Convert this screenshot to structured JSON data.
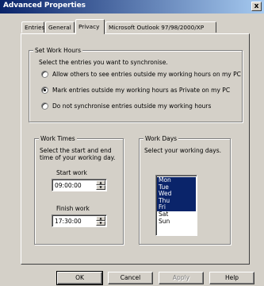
{
  "window": {
    "title": "Advanced Properties",
    "close_label": "x"
  },
  "tabs": [
    {
      "label": "Entries",
      "active": false
    },
    {
      "label": "General",
      "active": false
    },
    {
      "label": "Privacy",
      "active": true
    },
    {
      "label": "Microsoft Outlook 97/98/2000/XP",
      "active": false
    }
  ],
  "work_hours": {
    "legend": "Set Work Hours",
    "instruction": "Select the entries you want to synchronise.",
    "options": [
      {
        "label": "Allow others to see entries outside my working hours on my PC",
        "selected": false
      },
      {
        "label": "Mark entries outside my working hours as Private on my PC",
        "selected": true
      },
      {
        "label": "Do not synchronise entries outside my working hours",
        "selected": false
      }
    ]
  },
  "work_times": {
    "legend": "Work Times",
    "instruction_1": "Select the start and end",
    "instruction_2": "time of your working day.",
    "start_label": "Start work",
    "start_value": "09:00:00",
    "finish_label": "Finish work",
    "finish_value": "17:30:00"
  },
  "work_days": {
    "legend": "Work Days",
    "instruction": "Select your working days.",
    "days": [
      {
        "label": "Mon",
        "selected": true
      },
      {
        "label": "Tue",
        "selected": true
      },
      {
        "label": "Wed",
        "selected": true
      },
      {
        "label": "Thu",
        "selected": true
      },
      {
        "label": "Fri",
        "selected": true
      },
      {
        "label": "Sat",
        "selected": false
      },
      {
        "label": "Sun",
        "selected": false
      }
    ]
  },
  "buttons": {
    "ok": "OK",
    "cancel": "Cancel",
    "apply": "Apply",
    "help": "Help"
  }
}
